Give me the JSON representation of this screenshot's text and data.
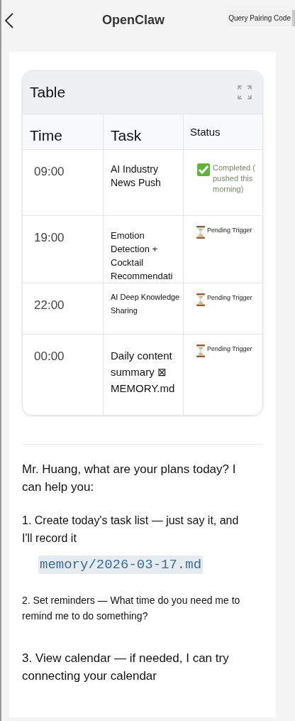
{
  "header": {
    "title": "OpenClaw",
    "action": "Query Pairing Code"
  },
  "table": {
    "title": "Table",
    "columns": [
      "Time",
      "Task",
      "Status"
    ],
    "rows": [
      {
        "time": "09:00",
        "task": "AI Industry News Push",
        "status": "Completed ( pushed this morning)",
        "kind": "completed"
      },
      {
        "time": "19:00",
        "task": "Emotion Detection + Cocktail Recommendati",
        "status": "Pending Trigger",
        "kind": "pending"
      },
      {
        "time": "22:00",
        "task": "AI Deep Knowledge Sharing",
        "status": "Pending Trigger",
        "kind": "pending"
      },
      {
        "time": "00:00",
        "task": "Daily content summary ⊠ MEMORY.md",
        "status": "Pending Trigger",
        "kind": "pending"
      }
    ]
  },
  "message": {
    "intro": "Mr. Huang, what are your plans today? I can help you:",
    "items": [
      {
        "text": "1. Create today's task list — just say it, and I'll record it",
        "code": "memory/2026-03-17.md"
      },
      {
        "text": "2. Set reminders — What time do you need me to remind me to do something?"
      },
      {
        "text": "3. View calendar — if needed, I can try connecting your calendar"
      }
    ]
  }
}
